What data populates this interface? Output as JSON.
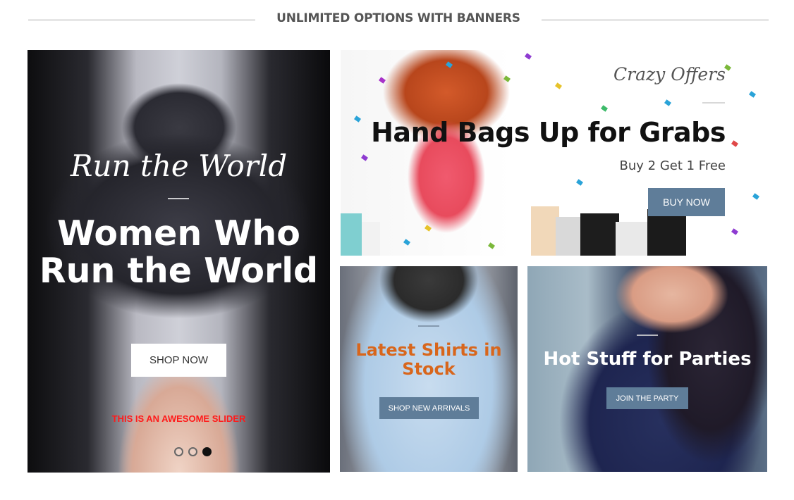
{
  "section": {
    "title": "UNLIMITED OPTIONS WITH BANNERS"
  },
  "slider": {
    "script_text": "Run the World",
    "heading": "Women Who Run the World",
    "button_label": "SHOP NOW",
    "note": "THIS IS AN AWESOME SLIDER",
    "dots_count": 3,
    "active_dot": 3
  },
  "crazy_offers": {
    "script_text": "Crazy Offers",
    "heading": "Hand Bags Up for Grabs",
    "subheading": "Buy 2 Get 1 Free",
    "button_label": "BUY NOW"
  },
  "shirts": {
    "heading": "Latest Shirts in Stock",
    "button_label": "SHOP NEW ARRIVALS"
  },
  "parties": {
    "heading": "Hot Stuff for Parties",
    "button_label": "JOIN THE PARTY"
  },
  "colors": {
    "button_blue": "#5f7d99",
    "shirts_heading": "#d8661c",
    "slider_note": "#ff1a1a"
  }
}
